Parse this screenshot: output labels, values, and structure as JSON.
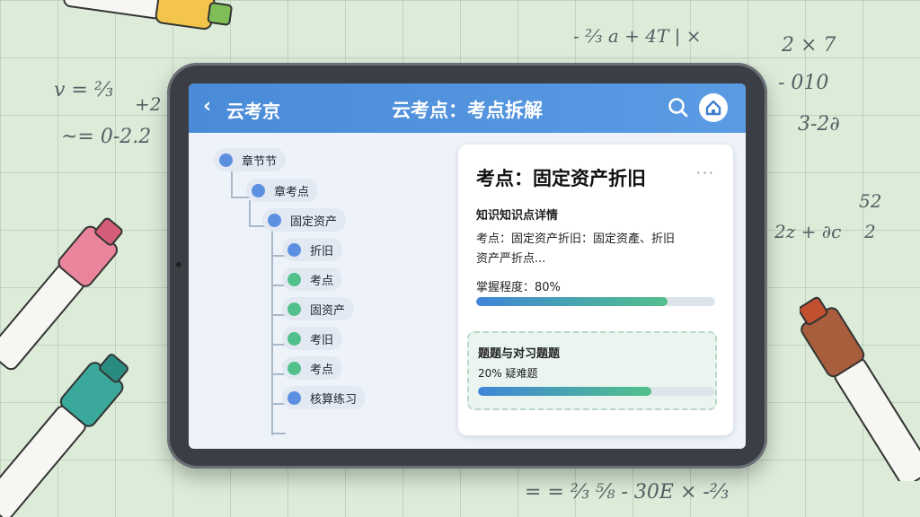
{
  "app": {
    "back_label": "‹",
    "name": "云考京",
    "page_title": "云考点：考点拆解"
  },
  "tree": {
    "nodes": [
      {
        "label": "章节节",
        "color": "blue"
      },
      {
        "label": "章考点",
        "color": "blue"
      },
      {
        "label": "固定资产",
        "color": "blue"
      },
      {
        "label": "折旧",
        "color": "blue"
      },
      {
        "label": "考点",
        "color": "green"
      },
      {
        "label": "固资产",
        "color": "green"
      },
      {
        "label": "考旧",
        "color": "green"
      },
      {
        "label": "考点",
        "color": "green"
      },
      {
        "label": "核算练习",
        "color": "blue"
      }
    ]
  },
  "card": {
    "title": "考点：固定资产折旧",
    "more": "···",
    "detail_heading": "知识知识点详情",
    "detail_line1": "考点：固定资产折旧：固定资產、折旧",
    "detail_line2": "资产严折点...",
    "mastery_label": "掌握程度：80%",
    "mastery_value": 0.8,
    "practice_heading": "题题与对习题题",
    "practice_sub": "20% 疑难题",
    "practice_value": 0.73
  },
  "colors": {
    "accent": "#4a8bd8",
    "green": "#52c08a",
    "blue_dot": "#5b8fe0"
  },
  "scribbles": {
    "s1": "- ⅔ a + 4T | ×",
    "s2": "2 × 7",
    "s3": "- 010",
    "s4": "3-2∂",
    "s5": "v = ⅔",
    "s6": "+2",
    "s7": "~= 0-2.2",
    "s8": "52",
    "s9": "2z + ∂c",
    "s10": "2",
    "s11": "= = ⅔ ⅝ - 30E × -⅔"
  }
}
